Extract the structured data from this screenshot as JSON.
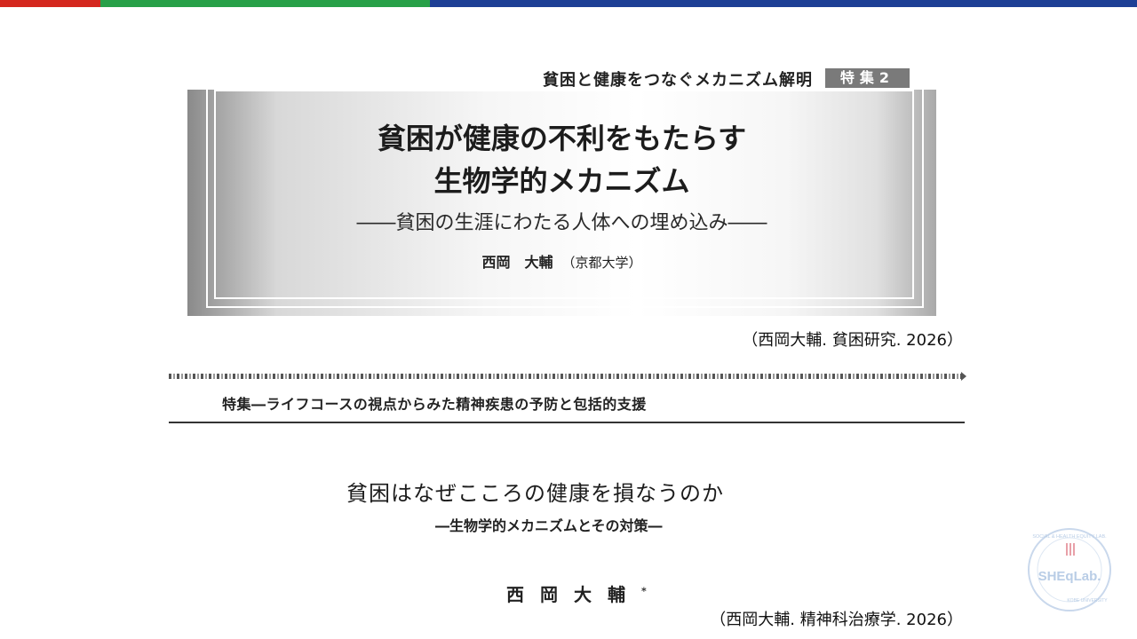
{
  "colors": {
    "bar_red": "#d4271e",
    "bar_green": "#27a048",
    "bar_blue": "#1d3f95",
    "logo": "#b9cde6"
  },
  "article1": {
    "topic": "貧困と健康をつなぐメカニズム解明",
    "badge": "特集2",
    "title_line1": "貧困が健康の不利をもたらす",
    "title_line2": "生物学的メカニズム",
    "subtitle": "――貧困の生涯にわたる人体への埋め込み――",
    "author": "西岡　大輔",
    "affiliation": "（京都大学）",
    "citation": "（西岡大輔. 貧困研究. 2026）"
  },
  "article2": {
    "series": "特集―ライフコースの視点からみた精神疾患の予防と包括的支援",
    "title": "貧困はなぜこころの健康を損なうのか",
    "subtitle": "―生物学的メカニズムとその対策―",
    "author": "西岡大輔",
    "author_mark": "*",
    "citation": "（西岡大輔. 精神科治療学. 2026）"
  },
  "logo": {
    "name": "SHEqLab.",
    "ring_text_top": "SOCIAL & HEALTH EQUITY LAB.",
    "ring_text_bottom": "KOBE UNIVERSITY",
    "icon": "cutlery-icon"
  }
}
